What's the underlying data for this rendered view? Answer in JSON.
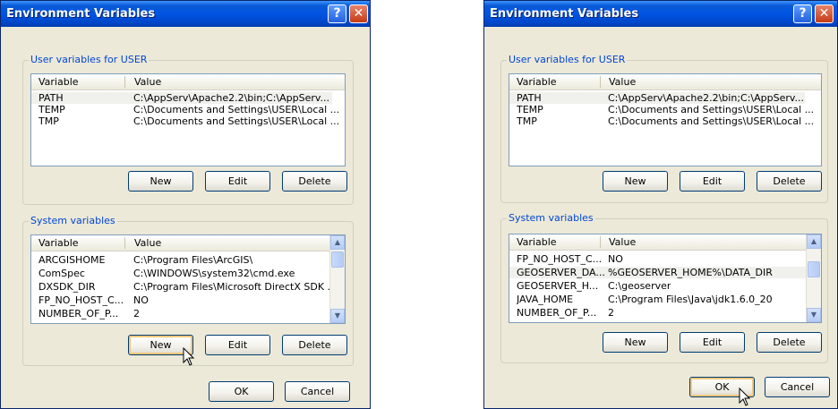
{
  "left": {
    "title": "Environment Variables",
    "user_group": "User variables for USER",
    "user_cols": [
      "Variable",
      "Value"
    ],
    "user_rows": [
      {
        "var": "PATH",
        "val": "C:\\AppServ\\Apache2.2\\bin;C:\\AppServ..."
      },
      {
        "var": "TEMP",
        "val": "C:\\Documents and Settings\\USER\\Local ..."
      },
      {
        "var": "TMP",
        "val": "C:\\Documents and Settings\\USER\\Local ..."
      }
    ],
    "user_buttons": [
      "New",
      "Edit",
      "Delete"
    ],
    "sys_group": "System variables",
    "sys_cols": [
      "Variable",
      "Value"
    ],
    "sys_rows": [
      {
        "var": "ARCGISHOME",
        "val": "C:\\Program Files\\ArcGIS\\"
      },
      {
        "var": "ComSpec",
        "val": "C:\\WINDOWS\\system32\\cmd.exe"
      },
      {
        "var": "DXSDK_DIR",
        "val": "C:\\Program Files\\Microsoft DirectX SDK ..."
      },
      {
        "var": "FP_NO_HOST_C...",
        "val": "NO"
      },
      {
        "var": "NUMBER_OF_P...",
        "val": "2"
      }
    ],
    "sys_buttons": [
      "New",
      "Edit",
      "Delete"
    ],
    "ok": "OK",
    "cancel": "Cancel"
  },
  "right": {
    "title": "Environment Variables",
    "user_group": "User variables for USER",
    "user_cols": [
      "Variable",
      "Value"
    ],
    "user_rows": [
      {
        "var": "PATH",
        "val": "C:\\AppServ\\Apache2.2\\bin;C:\\AppServ..."
      },
      {
        "var": "TEMP",
        "val": "C:\\Documents and Settings\\USER\\Local ..."
      },
      {
        "var": "TMP",
        "val": "C:\\Documents and Settings\\USER\\Local ..."
      }
    ],
    "user_buttons": [
      "New",
      "Edit",
      "Delete"
    ],
    "sys_group": "System variables",
    "sys_cols": [
      "Variable",
      "Value"
    ],
    "sys_rows": [
      {
        "var": "FP_NO_HOST_C...",
        "val": "NO"
      },
      {
        "var": "GEOSERVER_DA...",
        "val": "%GEOSERVER_HOME%\\DATA_DIR"
      },
      {
        "var": "GEOSERVER_H...",
        "val": "C:\\geoserver"
      },
      {
        "var": "JAVA_HOME",
        "val": "C:\\Program Files\\Java\\jdk1.6.0_20"
      },
      {
        "var": "NUMBER_OF_P...",
        "val": "2"
      }
    ],
    "sys_buttons": [
      "New",
      "Edit",
      "Delete"
    ],
    "ok": "OK",
    "cancel": "Cancel"
  },
  "icons": {
    "help": "?",
    "close": "✕",
    "scroll_up": "▲",
    "scroll_down": "▼"
  }
}
